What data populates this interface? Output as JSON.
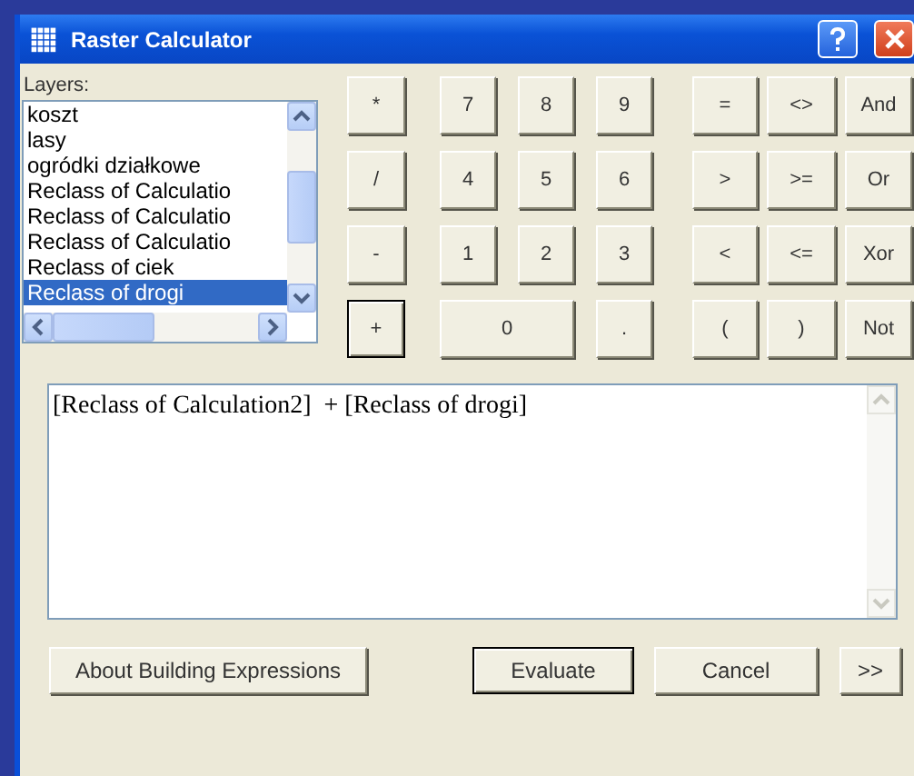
{
  "window": {
    "title": "Raster Calculator"
  },
  "layers": {
    "label": "Layers:",
    "items": [
      {
        "label": "koszt",
        "selected": false
      },
      {
        "label": "lasy",
        "selected": false
      },
      {
        "label": "ogródki działkowe",
        "selected": false
      },
      {
        "label": "Reclass of Calculatio",
        "selected": false
      },
      {
        "label": "Reclass of Calculatio",
        "selected": false
      },
      {
        "label": "Reclass of Calculatio",
        "selected": false
      },
      {
        "label": "Reclass of ciek",
        "selected": false
      },
      {
        "label": "Reclass of drogi",
        "selected": true
      }
    ]
  },
  "operators": [
    {
      "label": "*",
      "focused": false
    },
    {
      "label": "/",
      "focused": false
    },
    {
      "label": "-",
      "focused": false
    },
    {
      "label": "+",
      "focused": true
    }
  ],
  "numbers": [
    {
      "label": "7",
      "kind": "key"
    },
    {
      "label": "8",
      "kind": "key"
    },
    {
      "label": "9",
      "kind": "key"
    },
    {
      "label": "4",
      "kind": "key"
    },
    {
      "label": "5",
      "kind": "key"
    },
    {
      "label": "6",
      "kind": "key"
    },
    {
      "label": "1",
      "kind": "key"
    },
    {
      "label": "2",
      "kind": "key"
    },
    {
      "label": "3",
      "kind": "key"
    },
    {
      "label": "0",
      "kind": "wide"
    },
    {
      "label": ".",
      "kind": "key"
    }
  ],
  "comparisons": [
    "=",
    "<>",
    "And",
    ">",
    ">=",
    "Or",
    "<",
    "<=",
    "Xor",
    "(",
    ")",
    "Not"
  ],
  "expression": {
    "value": "[Reclass of Calculation2]  + [Reclass of drogi]"
  },
  "buttons": [
    {
      "label": "About Building Expressions",
      "default": false
    },
    {
      "label": "Evaluate",
      "default": true
    },
    {
      "label": "Cancel",
      "default": false
    },
    {
      "label": ">>",
      "default": false
    }
  ]
}
